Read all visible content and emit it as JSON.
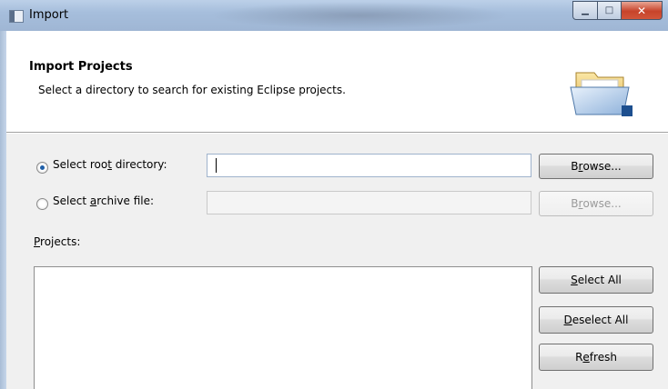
{
  "window": {
    "title": "Import",
    "controls": [
      "minimize",
      "maximize",
      "close"
    ]
  },
  "header": {
    "title": "Import Projects",
    "description": "Select a directory to search for existing Eclipse projects."
  },
  "source": {
    "root_radio": {
      "label_pre": "Select roo",
      "label_mn": "t",
      "label_post": " directory:",
      "selected": true
    },
    "root_input": {
      "value": ""
    },
    "root_browse": {
      "label_pre": "B",
      "label_mn": "r",
      "label_post": "owse..."
    },
    "archive_radio": {
      "label_pre": "Select ",
      "label_mn": "a",
      "label_post": "rchive file:",
      "selected": false
    },
    "archive_input": {
      "value": "",
      "disabled": true
    },
    "archive_browse": {
      "label_pre": "B",
      "label_mn": "r",
      "label_post": "owse...",
      "disabled": true
    }
  },
  "projects": {
    "label_mn": "P",
    "label_post": "rojects:",
    "items": [],
    "buttons": {
      "select_all": {
        "mn": "S",
        "rest": "elect All"
      },
      "deselect_all": {
        "mn": "D",
        "rest": "eselect All"
      },
      "refresh": {
        "pre": "R",
        "mn": "e",
        "rest": "fresh"
      }
    }
  }
}
